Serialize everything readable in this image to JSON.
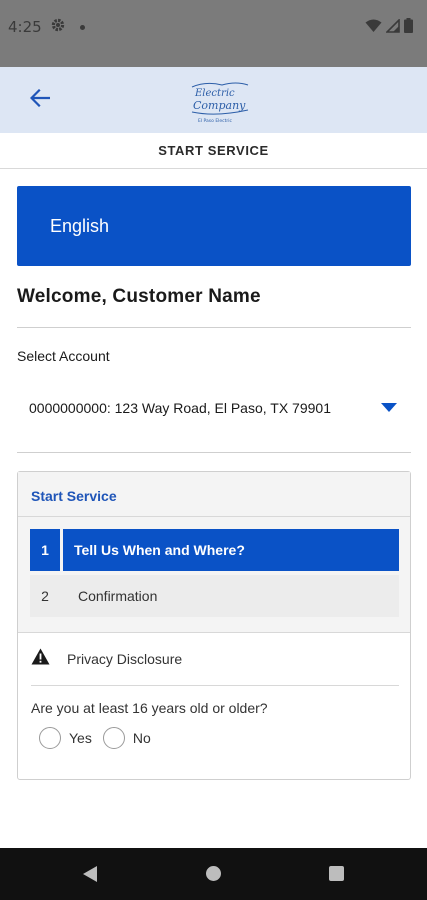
{
  "status_bar": {
    "time": "4:25",
    "icons": [
      "gear-icon",
      "notification-dot-icon",
      "wifi-icon",
      "signal-icon",
      "battery-icon"
    ]
  },
  "header": {
    "back_icon": "arrow-left-icon",
    "logo_text": "The Electric Company",
    "logo_subtext": "El Paso Electric",
    "accent_color": "#0a52c6",
    "background_color": "#dde6f4"
  },
  "page": {
    "title": "START SERVICE"
  },
  "language_button": {
    "label": "English"
  },
  "welcome": {
    "text": "Welcome, Customer Name"
  },
  "account": {
    "label": "Select Account",
    "selected_value": "0000000000: 123 Way Road, El Paso, TX 79901"
  },
  "service_card": {
    "title": "Start Service",
    "steps": [
      {
        "number": "1",
        "label": "Tell Us When and Where?",
        "active": true
      },
      {
        "number": "2",
        "label": "Confirmation",
        "active": false
      }
    ],
    "privacy": {
      "icon": "warning-icon",
      "label": "Privacy Disclosure"
    },
    "question": "Are you at least 16 years old or older?",
    "options": [
      {
        "label": "Yes",
        "selected": false
      },
      {
        "label": "No",
        "selected": false
      }
    ]
  },
  "nav_bar": {
    "icons": [
      "nav-back-icon",
      "nav-home-icon",
      "nav-recents-icon"
    ]
  }
}
